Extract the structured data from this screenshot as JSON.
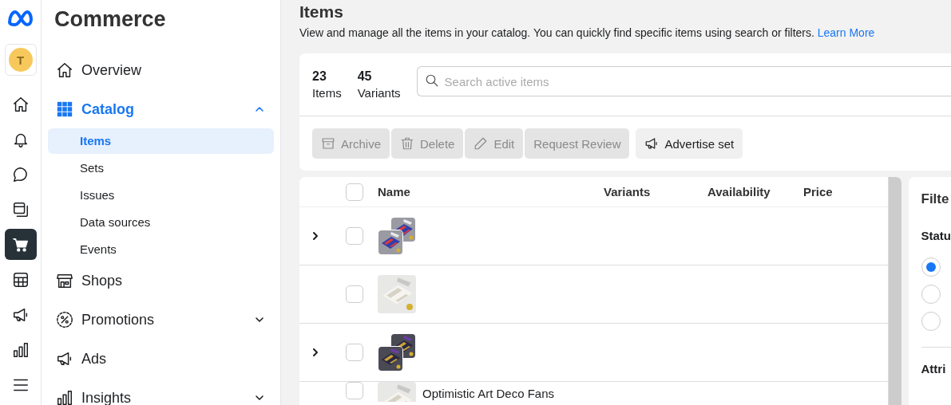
{
  "rail": {
    "avatar": "T",
    "items": [
      {
        "kind": "home",
        "selected": false
      },
      {
        "kind": "bell",
        "selected": false
      },
      {
        "kind": "chat",
        "selected": false
      },
      {
        "kind": "pages",
        "selected": false
      },
      {
        "kind": "cart",
        "selected": true
      },
      {
        "kind": "table",
        "selected": false
      },
      {
        "kind": "megaphone",
        "selected": false
      },
      {
        "kind": "chart",
        "selected": false
      },
      {
        "kind": "menu",
        "selected": false
      }
    ]
  },
  "sidebar": {
    "title": "Commerce",
    "items": [
      {
        "label": "Overview",
        "kind": "house",
        "selected": false
      },
      {
        "label": "Catalog",
        "kind": "grid",
        "selected": true,
        "expanded": true,
        "children": [
          {
            "label": "Items",
            "selected": true
          },
          {
            "label": "Sets",
            "selected": false
          },
          {
            "label": "Issues",
            "selected": false
          },
          {
            "label": "Data sources",
            "selected": false
          },
          {
            "label": "Events",
            "selected": false
          }
        ]
      },
      {
        "label": "Shops",
        "kind": "store",
        "selected": false
      },
      {
        "label": "Promotions",
        "kind": "percent",
        "selected": false,
        "expanded": false
      },
      {
        "label": "Ads",
        "kind": "megaphone",
        "selected": false
      },
      {
        "label": "Insights",
        "kind": "chart",
        "selected": false,
        "expanded": false
      }
    ]
  },
  "page": {
    "title": "Items",
    "description": "View and manage all the items in your catalog. You can quickly find specific items using search or filters.",
    "link": "Learn More"
  },
  "summary": {
    "stats": [
      {
        "value": "23",
        "label": "Items"
      },
      {
        "value": "45",
        "label": "Variants"
      }
    ],
    "search": {
      "placeholder": "Search active items"
    }
  },
  "actions": [
    {
      "label": "Archive",
      "kind": "archive",
      "disabled": true
    },
    {
      "label": "Delete",
      "kind": "trash",
      "disabled": true
    },
    {
      "label": "Edit",
      "kind": "pencil",
      "disabled": true
    },
    {
      "label": "Request Review",
      "kind": "none",
      "disabled": true
    },
    {
      "label": "Advertise set",
      "kind": "megaphone",
      "disabled": false
    }
  ],
  "table": {
    "select_all": {
      "checked": false
    },
    "columns": [
      "Name",
      "Variants",
      "Availability",
      "Price"
    ],
    "rows": [
      {
        "expandable": true,
        "checked": false,
        "kind": "stack"
      },
      {
        "expandable": false,
        "checked": false,
        "kind": "single"
      },
      {
        "expandable": true,
        "checked": false,
        "kind": "stack"
      },
      {
        "expandable": false,
        "checked": false,
        "kind": "single",
        "name": "Optimistic Art Deco Fans"
      }
    ]
  },
  "filters": {
    "title": "Filte",
    "status_heading": "Statu",
    "status_options": [
      {
        "selected": true
      },
      {
        "selected": false
      },
      {
        "selected": false
      }
    ],
    "attributes_heading": "Attri"
  }
}
